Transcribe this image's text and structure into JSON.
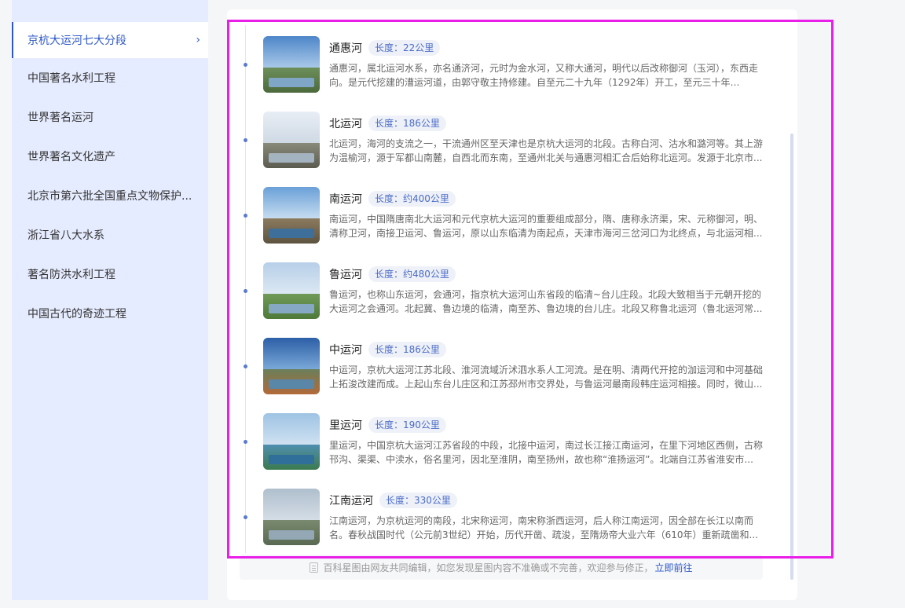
{
  "sidebar": {
    "items": [
      {
        "label": "京杭大运河七大分段",
        "active": true
      },
      {
        "label": "中国著名水利工程"
      },
      {
        "label": "世界著名运河"
      },
      {
        "label": "世界著名文化遗产"
      },
      {
        "label": "北京市第六批全国重点文物保护..."
      },
      {
        "label": "浙江省八大水系"
      },
      {
        "label": "著名防洪水利工程"
      },
      {
        "label": "中国古代的奇迹工程"
      }
    ]
  },
  "rivers": [
    {
      "name": "通惠河",
      "length": "长度：22公里",
      "desc": "通惠河，属北运河水系，亦名通济河，元时为金水河，又称大通河，明代以后改称御河（玉河），东西走向。是元代挖建的漕运河道，由郭守敬主持修建。自至元二十九年（1292年）开工，至元三十年（129..."
    },
    {
      "name": "北运河",
      "length": "长度：186公里",
      "desc": "北运河，海河的支流之一，干流通州区至天津也是京杭大运河的北段。古称白河、沽水和潞河等。其上游为温榆河，源于军都山南麓，自西北而东南，至通州北关与通惠河相汇合后始称北运河。发源于北京市..."
    },
    {
      "name": "南运河",
      "length": "长度：约400公里",
      "desc": "南运河，中国隋唐南北大运河和元代京杭大运河的重要组成部分，隋、唐称永济渠，宋、元称御河，明、清称卫河，南接卫运河、鲁运河，原以山东临清为南起点，天津市海河三岔河口为北终点，与北运河相..."
    },
    {
      "name": "鲁运河",
      "length": "长度：约480公里",
      "desc": "鲁运河，也称山东运河，会通河，指京杭大运河山东省段的临清~台儿庄段。北段大致相当于元朝开挖的大运河之会通河。北起冀、鲁边境的临清，南至苏、鲁边境的台儿庄。北段又称鲁北运河（鲁北运河常..."
    },
    {
      "name": "中运河",
      "length": "长度：186公里",
      "desc": "中运河，京杭大运河江苏北段、淮河流域沂沭泗水系人工河流。是在明、清两代开挖的泇运河和中河基础上拓浚改建而成。上起山东台儿庄区和江苏邳州市交界处，与鲁运河最南段韩庄运河相接。同时，微山..."
    },
    {
      "name": "里运河",
      "length": "长度：190公里",
      "desc": "里运河，中国京杭大运河江苏省段的中段，北接中运河，南过长江接江南运河，在里下河地区西侧，古称邗沟、渠渠、中渎水，俗名里河，因北至淮阴，南至扬州，故也称“淮扬运河”。北端自江苏省淮安市..."
    },
    {
      "name": "江南运河",
      "length": "长度：330公里",
      "desc": "江南运河，为京杭运河的南段，北宋称运河，南宋称浙西运河，后人称江南运河，因全部在长江以南而名。春秋战国时代（公元前3世纪）开始，历代开凿、疏浚，至隋炀帝大业六年（610年）重新疏凿和..."
    }
  ],
  "footer": {
    "note": "百科星图由网友共同编辑，如您发现星图内容不准确或不完善，欢迎参与修正，",
    "link": "立即前往"
  },
  "colors": {
    "accent": "#2e58c8",
    "sidebar_bg": "#e6ecff",
    "highlight": "#e91ee9"
  }
}
